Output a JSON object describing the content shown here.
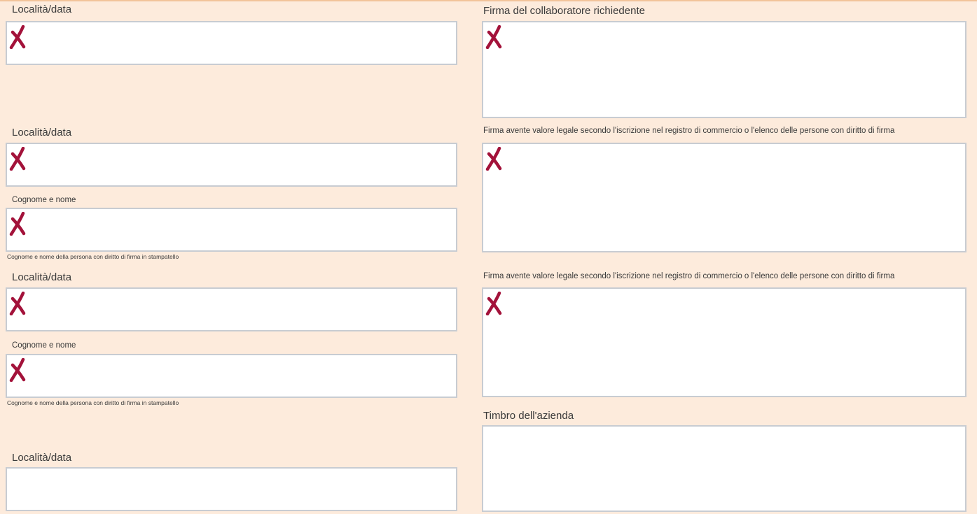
{
  "form": {
    "left": {
      "block1": {
        "location_date_label": "Località/data"
      },
      "block2": {
        "location_date_label": "Località/data",
        "name_label": "Cognome e nome",
        "name_hint": "Cognome e nome della persona con diritto di firma in stampatello"
      },
      "block3": {
        "location_date_label": "Località/data",
        "name_label": "Cognome e nome",
        "name_hint": "Cognome e nome della persona con diritto di firma in stampatello"
      },
      "block4": {
        "location_date_label": "Località/data"
      }
    },
    "right": {
      "employee_signature_label": "Firma del collaboratore richiedente",
      "legal_signature_label_1": "Firma avente valore legale secondo l'iscrizione nel registro di commercio o l'elenco delle persone con diritto di firma",
      "legal_signature_label_2": "Firma avente valore legale secondo l'iscrizione nel registro di commercio o l'elenco delle persone con diritto di firma",
      "company_stamp_label": "Timbro dell'azienda"
    }
  },
  "colors": {
    "background": "#fdebdc",
    "field_border": "#c8ccd2",
    "required_mark": "#a3123a"
  },
  "icons": {
    "required_mark": "x-mark-icon"
  }
}
